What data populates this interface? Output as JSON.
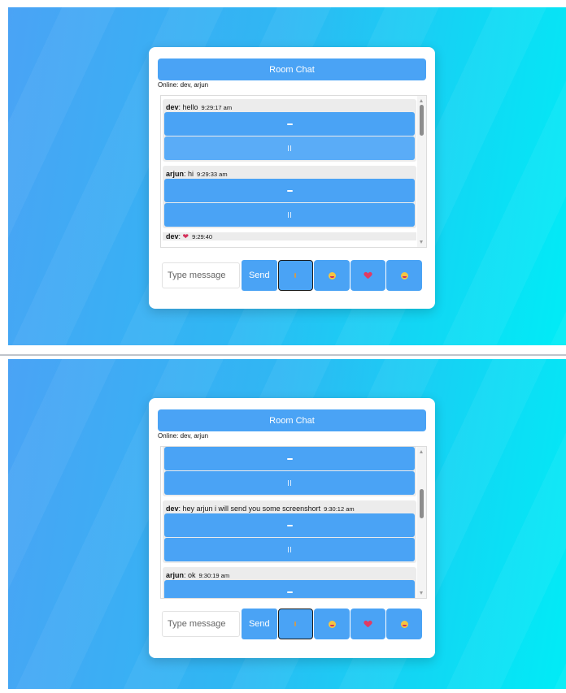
{
  "header": {
    "title": "Room Chat"
  },
  "online_text": "Online: dev, arjun",
  "composer": {
    "placeholder": "Type message",
    "send_label": "Send",
    "buttons": [
      "mic-icon",
      "grinning-face-icon",
      "broken-heart-icon",
      "tongue-face-icon"
    ]
  },
  "top_messages": [
    {
      "user": "dev",
      "sep": ":",
      "text": " hello",
      "time": "9:29:17 am"
    },
    {
      "user": "arjun",
      "sep": ":",
      "text": " hi",
      "time": "9:29:33 am"
    },
    {
      "user": "dev",
      "sep": ":",
      "text": " ❤",
      "time": "9:29:40"
    }
  ],
  "bottom_messages": [
    {
      "user": "dev",
      "sep": ":",
      "text": " hey arjun i will send you some screenshort",
      "time": "9:30:12 am"
    },
    {
      "user": "arjun",
      "sep": ":",
      "text": " ok",
      "time": "9:30:19 am"
    }
  ],
  "colors": {
    "accent": "#4aa3f5",
    "background_start": "#4aa3f5",
    "background_end": "#00ecf6"
  }
}
